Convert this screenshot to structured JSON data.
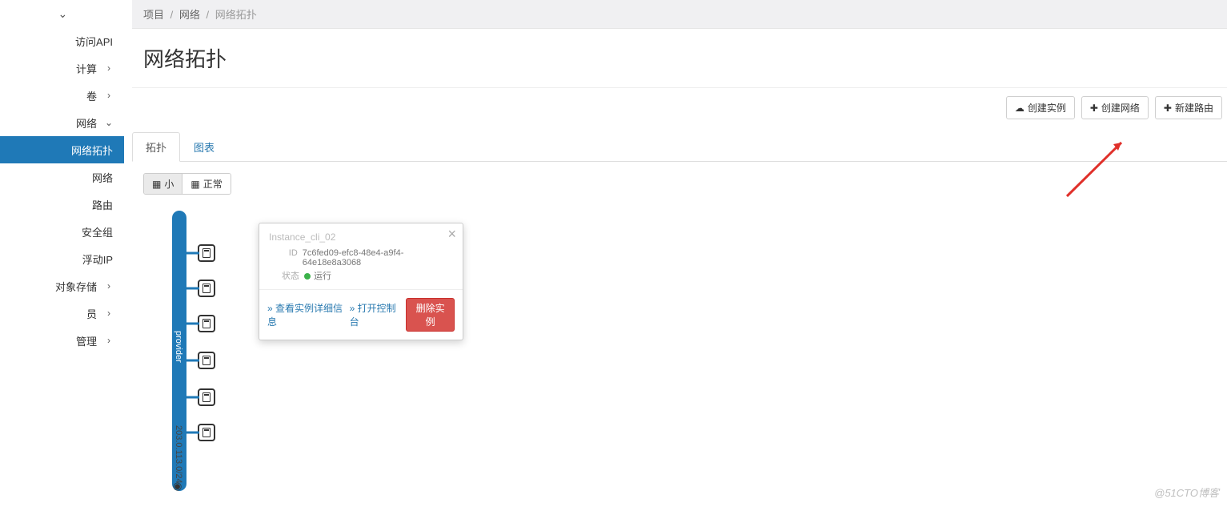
{
  "sidebar": {
    "api_link": "访问API",
    "items": [
      {
        "label": "计算",
        "has_chevron": true
      },
      {
        "label": "卷",
        "has_chevron": true
      },
      {
        "label": "网络",
        "has_chevron": true,
        "expanded": true
      }
    ],
    "network_children": [
      {
        "label": "网络拓扑",
        "active": true
      },
      {
        "label": "网络"
      },
      {
        "label": "路由"
      },
      {
        "label": "安全组"
      },
      {
        "label": "浮动IP"
      }
    ],
    "tail_items": [
      {
        "label": "对象存储",
        "has_chevron": true
      },
      {
        "label": "员",
        "has_chevron": true
      },
      {
        "label": "管理",
        "has_chevron": true
      }
    ]
  },
  "breadcrumb": {
    "a": "项目",
    "b": "网络",
    "c": "网络拓扑",
    "sep": "/"
  },
  "page_title": "网络拓扑",
  "buttons": {
    "create_instance": "创建实例",
    "create_network": "创建网络",
    "create_router": "新建路由"
  },
  "tabs": {
    "topology": "拓扑",
    "chart": "图表"
  },
  "view_toggle": {
    "small": "小",
    "normal": "正常"
  },
  "topology": {
    "network_name": "provider",
    "cidr": "203.0.113.0/24",
    "instance_count": 6
  },
  "popover": {
    "title": "Instance_cli_02",
    "id_label": "ID",
    "id_value": "7c6fed09-efc8-48e4-a9f4-64e18e8a3068",
    "status_label": "状态",
    "status_value": "运行",
    "view_detail": "» 查看实例详细信息",
    "open_console": "» 打开控制台",
    "delete": "删除实例"
  },
  "watermark": "@51CTO博客"
}
